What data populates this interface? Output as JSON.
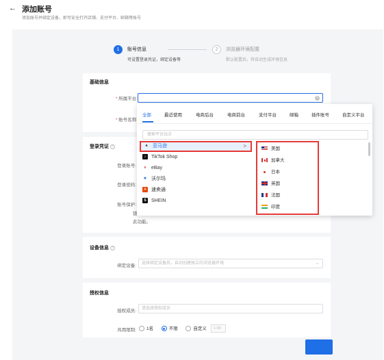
{
  "header": {
    "back_icon": "←",
    "title": "添加账号",
    "subtitle": "添加账号并绑定设备，即可安全打开店铺、支付平台、邮箱等账号"
  },
  "steps": [
    {
      "num": "1",
      "title": "账号信息",
      "desc": "可设置登录凭证，绑定设备等"
    },
    {
      "num": "2",
      "title": "浏览器环境配置",
      "desc": "默认配置后，将自动生成环境信息"
    }
  ],
  "basic": {
    "title": "基础信息",
    "platform_label": "所属平台:",
    "account_name_label": "账号名称:"
  },
  "login": {
    "title": "登录凭证",
    "account_label": "登录账号:",
    "password_label": "登录密码:",
    "protect_label": "账号保护:",
    "protect_partial": "锁",
    "protect_note": "此功能。"
  },
  "dropdown": {
    "tabs": [
      "全部",
      "最近使用",
      "电商后台",
      "电商前台",
      "支付平台",
      "邮箱",
      "插件账号",
      "自定义平台"
    ],
    "search_placeholder": "搜索平台站点",
    "platforms": [
      {
        "name": "亚马逊",
        "logo": "a",
        "color": "#222",
        "bg": "#fff"
      },
      {
        "name": "TikTok Shop",
        "logo": "♪",
        "color": "#fff",
        "bg": "#111"
      },
      {
        "name": "eBay",
        "logo": "e",
        "color": "#e53238",
        "bg": "#fff"
      },
      {
        "name": "沃尔玛",
        "logo": "✱",
        "color": "#1f6fe6",
        "bg": "#fff"
      },
      {
        "name": "速卖通",
        "logo": "A",
        "color": "#fff",
        "bg": "#e8470a"
      },
      {
        "name": "SHEIN",
        "logo": "S",
        "color": "#fff",
        "bg": "#111"
      }
    ],
    "chevron": ">",
    "countries": [
      "美国",
      "加拿大",
      "日本",
      "英国",
      "法国",
      "印度"
    ]
  },
  "device": {
    "title": "设备信息",
    "bind_label": "绑定设备:",
    "bind_placeholder": "选择绑定设备后，自动创建独立的浏览器环境"
  },
  "auth": {
    "title": "授权信息",
    "member_label": "授权成员:",
    "member_placeholder": "请选择授权成员",
    "share_label": "共用限制:",
    "opt1": "1名",
    "opt2": "不限",
    "opt3": "自定义",
    "custom_placeholder": "1-99"
  }
}
